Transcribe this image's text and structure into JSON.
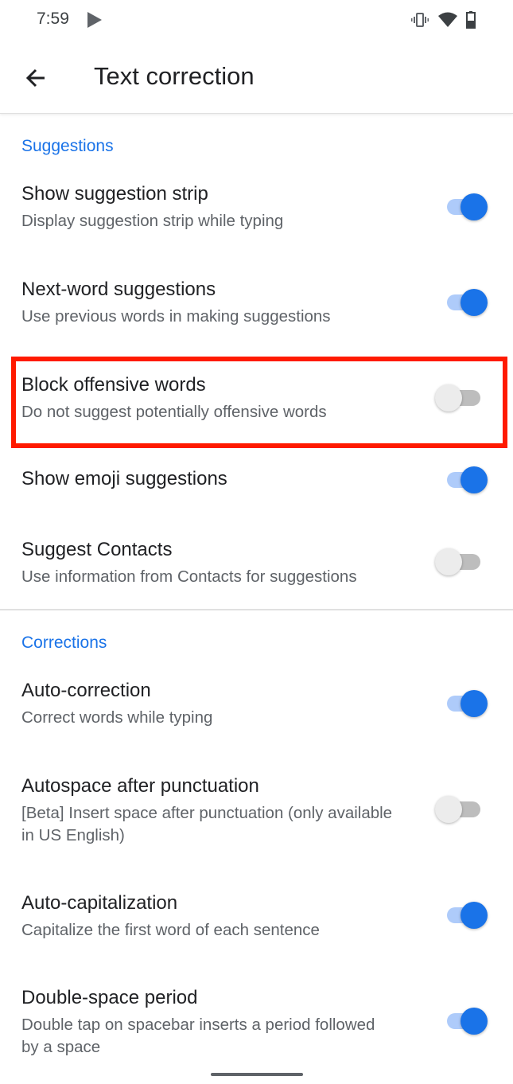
{
  "status_bar": {
    "time": "7:59",
    "icons": [
      "play-store-icon",
      "vibrate-icon",
      "wifi-icon",
      "battery-icon"
    ]
  },
  "app_bar": {
    "back_icon": "arrow-back-icon",
    "title": "Text correction"
  },
  "sections": [
    {
      "header": "Suggestions",
      "items": [
        {
          "title": "Show suggestion strip",
          "summary": "Display suggestion strip while typing",
          "enabled": true
        },
        {
          "title": "Next-word suggestions",
          "summary": "Use previous words in making suggestions",
          "enabled": true
        },
        {
          "title": "Block offensive words",
          "summary": "Do not suggest potentially offensive words",
          "enabled": false,
          "highlighted": true
        },
        {
          "title": "Show emoji suggestions",
          "summary": "",
          "enabled": true
        },
        {
          "title": "Suggest Contacts",
          "summary": "Use information from Contacts for suggestions",
          "enabled": false
        }
      ]
    },
    {
      "header": "Corrections",
      "items": [
        {
          "title": "Auto-correction",
          "summary": "Correct words while typing",
          "enabled": true
        },
        {
          "title": "Autospace after punctuation",
          "summary": "[Beta] Insert space after punctuation (only available in US English)",
          "enabled": false
        },
        {
          "title": "Auto-capitalization",
          "summary": "Capitalize the first word of each sentence",
          "enabled": true
        },
        {
          "title": "Double-space period",
          "summary": "Double tap on spacebar inserts a period followed by a space",
          "enabled": true
        }
      ]
    }
  ],
  "colors": {
    "accent": "#1a73e8",
    "highlight": "#ff1a00"
  }
}
